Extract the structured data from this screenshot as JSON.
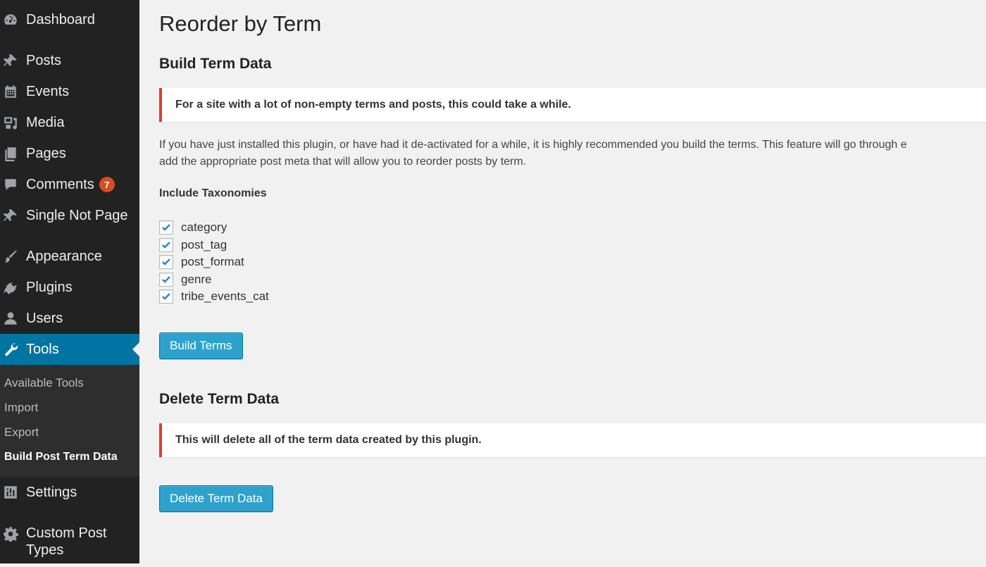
{
  "sidebar": {
    "items": [
      {
        "label": "Dashboard",
        "icon": "dashboard-icon"
      },
      {
        "label": "Posts",
        "icon": "pin-icon"
      },
      {
        "label": "Events",
        "icon": "calendar-icon"
      },
      {
        "label": "Media",
        "icon": "media-icon"
      },
      {
        "label": "Pages",
        "icon": "pages-icon"
      },
      {
        "label": "Comments",
        "icon": "comment-icon",
        "badge": "7"
      },
      {
        "label": "Single Not Page",
        "icon": "pin-icon"
      },
      {
        "label": "Appearance",
        "icon": "brush-icon"
      },
      {
        "label": "Plugins",
        "icon": "plug-icon"
      },
      {
        "label": "Users",
        "icon": "user-icon"
      },
      {
        "label": "Tools",
        "icon": "wrench-icon",
        "active": true
      },
      {
        "label": "Settings",
        "icon": "sliders-icon"
      },
      {
        "label": "Custom Post Types",
        "icon": "gear-icon"
      }
    ],
    "submenu": [
      {
        "label": "Available Tools"
      },
      {
        "label": "Import"
      },
      {
        "label": "Export"
      },
      {
        "label": "Build Post Term Data",
        "current": true
      }
    ]
  },
  "main": {
    "title": "Reorder by Term",
    "build": {
      "heading": "Build Term Data",
      "notice": "For a site with a lot of non-empty terms and posts, this could take a while.",
      "description_line1": "If you have just installed this plugin, or have had it de-activated for a while, it is highly recommended you build the terms. This feature will go through e",
      "description_line2": "add the appropriate post meta that will allow you to reorder posts by term.",
      "taxonomies_label": "Include Taxonomies",
      "taxonomies": [
        {
          "name": "category",
          "checked": true
        },
        {
          "name": "post_tag",
          "checked": true
        },
        {
          "name": "post_format",
          "checked": true
        },
        {
          "name": "genre",
          "checked": true
        },
        {
          "name": "tribe_events_cat",
          "checked": true
        }
      ],
      "button_label": "Build Terms"
    },
    "delete": {
      "heading": "Delete Term Data",
      "notice": "This will delete all of the term data created by this plugin.",
      "button_label": "Delete Term Data"
    }
  },
  "colors": {
    "sidebar_bg": "#222222",
    "active_menu": "#0074a2",
    "button": "#2ea2cc",
    "notice_border": "#dd3d36",
    "badge": "#d54e21",
    "checkmark": "#1e8cbe"
  }
}
